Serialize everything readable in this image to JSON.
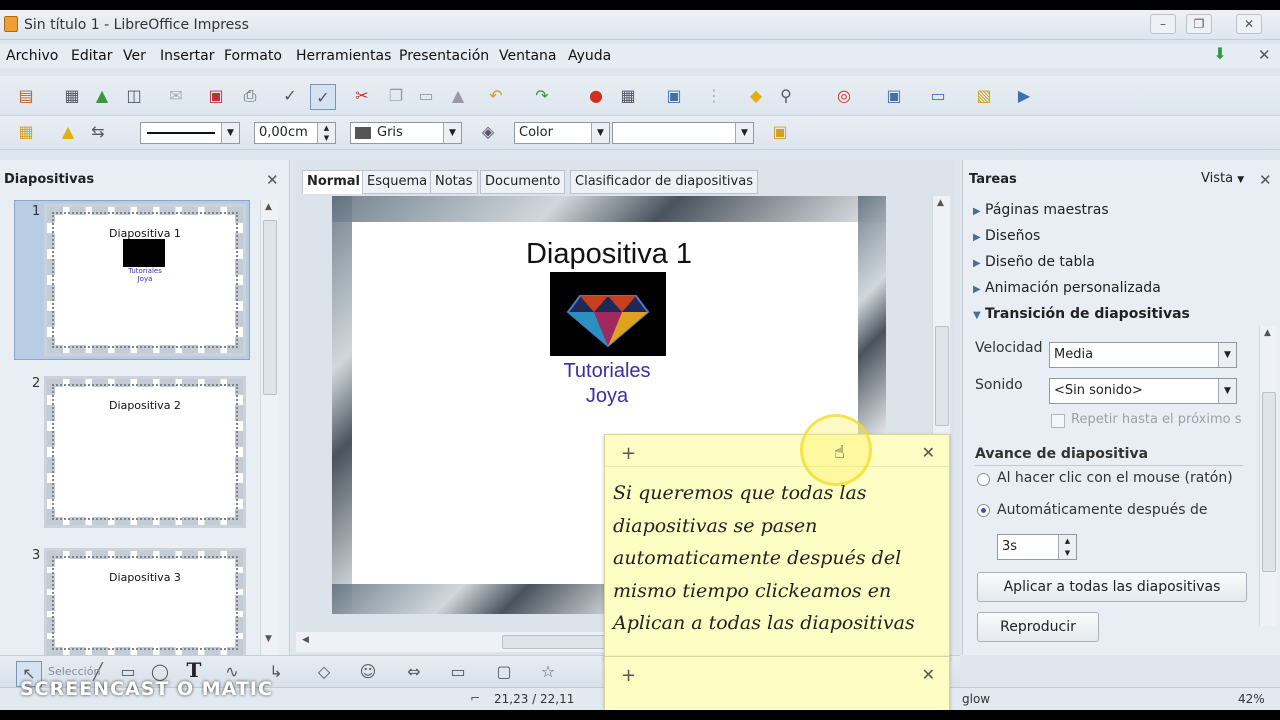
{
  "window": {
    "title": "Sin título 1 - LibreOffice Impress"
  },
  "menu": [
    "Archivo",
    "Editar",
    "Ver",
    "Insertar",
    "Formato",
    "Herramientas",
    "Presentación",
    "Ventana",
    "Ayuda"
  ],
  "format_toolbar": {
    "line_width": "0,00cm",
    "area_color": "Gris",
    "fill_mode": "Color",
    "fill_value": ""
  },
  "slides_panel": {
    "title": "Diapositivas",
    "slides": [
      {
        "num": "1",
        "title": "Diapositiva 1",
        "sub1": "Tutoriales",
        "sub2": "Joya"
      },
      {
        "num": "2",
        "title": "Diapositiva 2"
      },
      {
        "num": "3",
        "title": "Diapositiva 3"
      }
    ]
  },
  "editor": {
    "tabs": [
      "Normal",
      "Esquema",
      "Notas",
      "Documento",
      "Clasificador de diapositivas"
    ],
    "active_tab": "Normal",
    "slide": {
      "title": "Diapositiva 1",
      "sub1": "Tutoriales",
      "sub2": "Joya"
    }
  },
  "tasks_panel": {
    "title": "Tareas",
    "view_label": "Vista",
    "sections": [
      "Páginas maestras",
      "Diseños",
      "Diseño de tabla",
      "Animación personalizada",
      "Transición de diapositivas"
    ],
    "speed_label": "Velocidad",
    "speed_value": "Media",
    "sound_label": "Sonido",
    "sound_value": "<Sin sonido>",
    "repeat_label": "Repetir hasta el próximo s",
    "advance_title": "Avance de diapositiva",
    "radio_click": "Al hacer clic con el mouse (ratón)",
    "radio_auto": "Automáticamente después de",
    "auto_value": "3s",
    "apply_all": "Aplicar a todas las diapositivas",
    "play": "Reproducir"
  },
  "note": {
    "line1": "Si queremos que todas las",
    "line2": "diapositivas se pasen",
    "line3": "automaticamente después del",
    "line4": "mismo tiempo clickeamos en",
    "line5": "Aplican a todas las diapositivas"
  },
  "statusbar": {
    "position": "21,23 / 22,11",
    "layout": "glow",
    "zoom": "42%"
  },
  "watermark": {
    "text": "SCREENCAST O MATIC",
    "overlay_label": "Selección"
  }
}
